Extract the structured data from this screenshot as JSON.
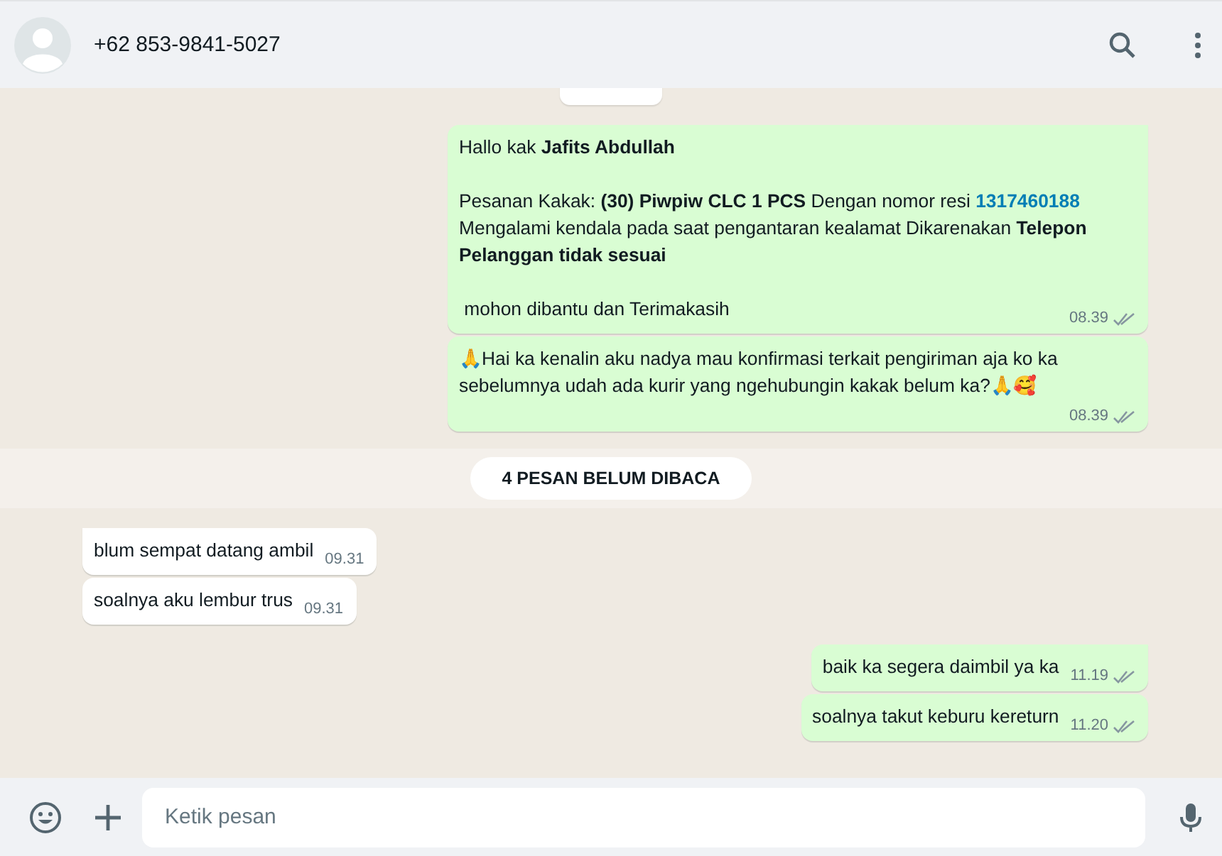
{
  "header": {
    "contact": "+62 853-9841-5027"
  },
  "messages": [
    {
      "outgoing": true,
      "tail": true,
      "read": false,
      "time": "08.39",
      "paragraphs": [
        [
          {
            "kind": "text",
            "text": "Hallo kak **Jafits Abdullah**"
          }
        ],
        [
          {
            "kind": "text",
            "text": "Pesanan Kakak: **(30) Piwpiw CLC 1 PCS** Dengan nomor resi "
          },
          {
            "kind": "link",
            "text": "1317460188"
          },
          {
            "kind": "text",
            "text": " Mengalami kendala pada saat pengantaran kealamat Dikarenakan **Telepon Pelanggan tidak sesuai**"
          }
        ],
        [
          {
            "kind": "text",
            "text": " mohon dibantu dan Terimakasih"
          }
        ]
      ]
    },
    {
      "outgoing": true,
      "tail": false,
      "read": false,
      "time": "08.39",
      "paragraphs": [
        [
          {
            "kind": "text",
            "text": "🙏Hai ka kenalin aku nadya mau konfirmasi terkait pengiriman aja ko ka sebelumnya udah ada kurir yang ngehubungin kakak belum ka?🙏🥰"
          }
        ]
      ]
    },
    {
      "kind": "unread",
      "text": "4 PESAN BELUM DIBACA"
    },
    {
      "outgoing": false,
      "tail": true,
      "time": "09.31",
      "paragraphs": [
        [
          {
            "kind": "text",
            "text": "blum sempat datang ambil"
          }
        ]
      ]
    },
    {
      "outgoing": false,
      "tail": false,
      "time": "09.31",
      "paragraphs": [
        [
          {
            "kind": "text",
            "text": "soalnya aku lembur trus"
          }
        ]
      ]
    },
    {
      "kind": "gap"
    },
    {
      "outgoing": true,
      "tail": true,
      "read": false,
      "time": "11.19",
      "paragraphs": [
        [
          {
            "kind": "text",
            "text": "baik ka segera daimbil ya ka"
          }
        ]
      ]
    },
    {
      "outgoing": true,
      "tail": false,
      "read": false,
      "time": "11.20",
      "paragraphs": [
        [
          {
            "kind": "text",
            "text": "soalnya takut keburu kereturn"
          }
        ]
      ]
    }
  ],
  "composer": {
    "placeholder": "Ketik pesan"
  }
}
